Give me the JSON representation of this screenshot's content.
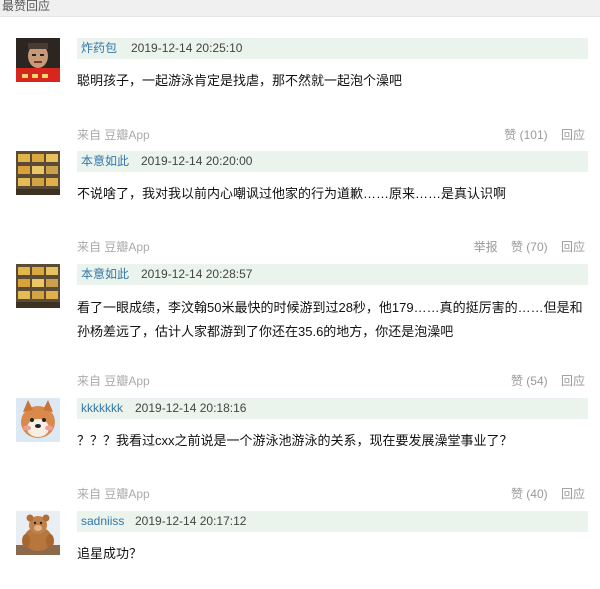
{
  "section": {
    "title": "最赞回应"
  },
  "comments": [
    {
      "author": "炸药包",
      "time": "2019-12-14 20:25:10",
      "text": "聪明孩子，一起游泳肯定是找虐，那不然就一起泡个澡吧",
      "source_prefix": "来自",
      "source_app": "豆瓣App",
      "report": "",
      "vote": "赞 (101)",
      "reply": "回应"
    },
    {
      "author": "本意如此",
      "time": "2019-12-14 20:20:00",
      "text": "不说啥了，我对我以前内心嘲讽过他家的行为道歉……原来……是真认识啊",
      "source_prefix": "来自",
      "source_app": "豆瓣App",
      "report": "举报",
      "vote": "赞 (70)",
      "reply": "回应"
    },
    {
      "author": "本意如此",
      "time": "2019-12-14 20:28:57",
      "text_line1": "看了一眼成绩，李汶翰50米最快的时候游到过28秒，他179……真的挺厉害的……但是和",
      "text_line2": "孙杨差远了，估计人家都游到了你还在35.6的地方，你还是泡澡吧",
      "source_prefix": "来自",
      "source_app": "豆瓣App",
      "report": "",
      "vote": "赞 (54)",
      "reply": "回应"
    },
    {
      "author": "kkkkkkk",
      "time": "2019-12-14 20:18:16",
      "text": "？？？我看过cxx之前说是一个游泳池游泳的关系，现在要发展澡堂事业了？",
      "source_prefix": "来自",
      "source_app": "豆瓣App",
      "report": "",
      "vote": "赞 (40)",
      "reply": "回应"
    },
    {
      "author": "sadniiss",
      "time": "2019-12-14 20:17:12",
      "text": "追星成功？"
    }
  ]
}
